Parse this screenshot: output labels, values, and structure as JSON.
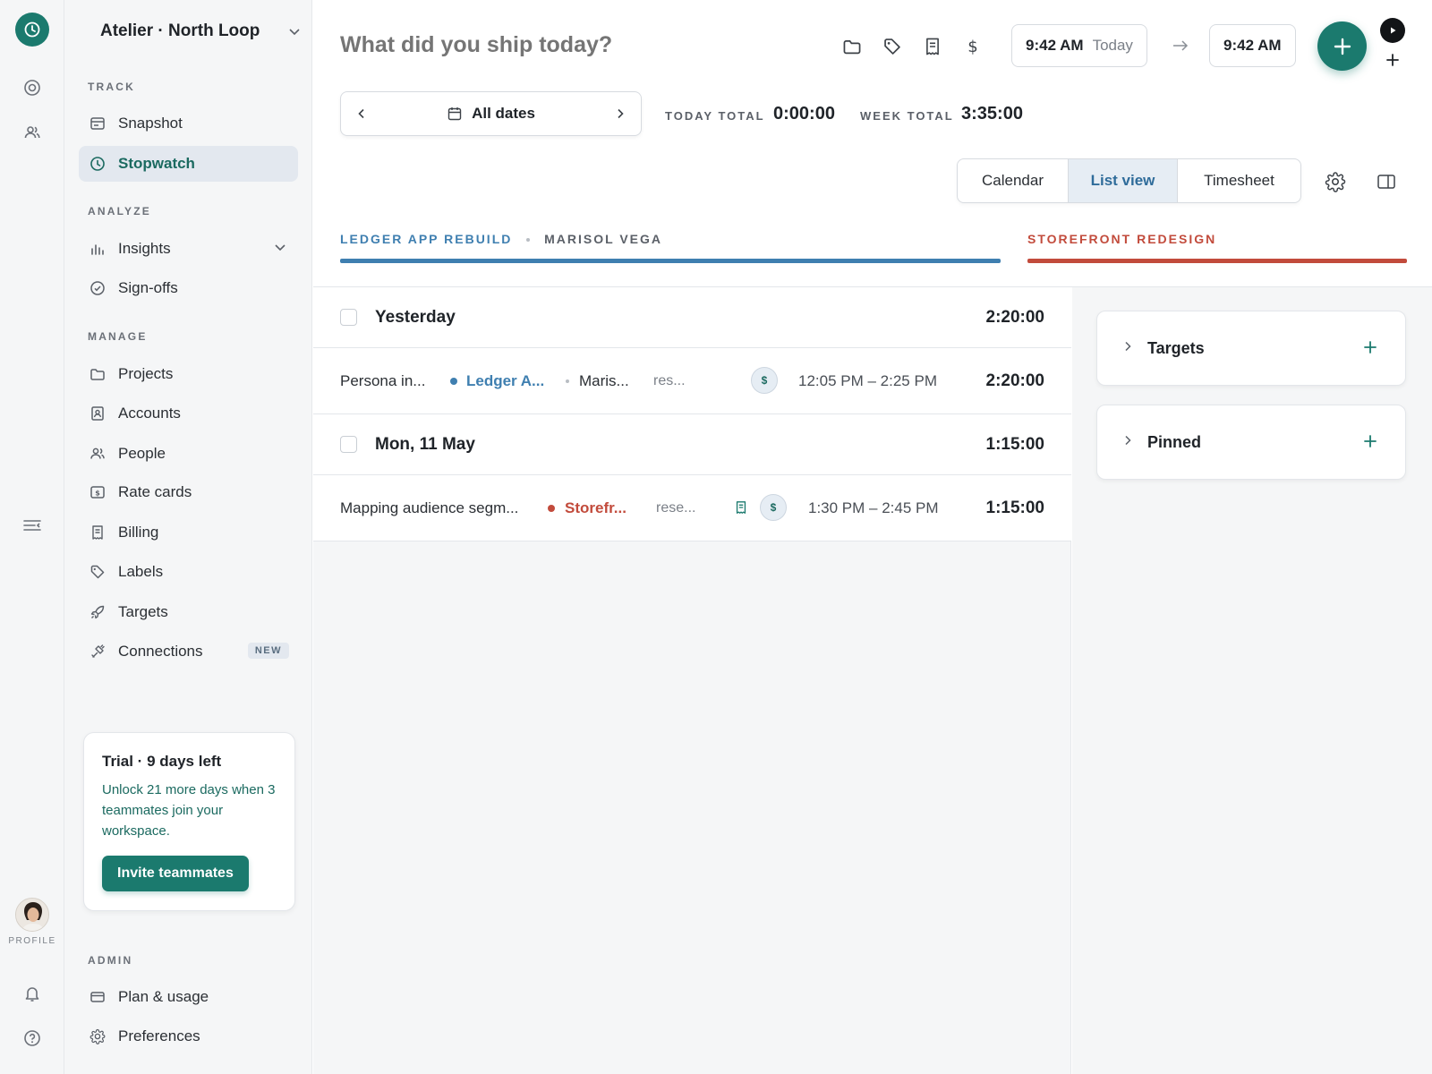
{
  "rail": {
    "profile_label": "PROFILE"
  },
  "workspace": {
    "name": "Atelier · North Loop"
  },
  "sidebar": {
    "sections": {
      "track": "TRACK",
      "analyze": "ANALYZE",
      "manage": "MANAGE",
      "admin": "ADMIN"
    },
    "items": {
      "snapshot": "Snapshot",
      "stopwatch": "Stopwatch",
      "insights": "Insights",
      "signoffs": "Sign-offs",
      "projects": "Projects",
      "accounts": "Accounts",
      "people": "People",
      "ratecards": "Rate cards",
      "billing": "Billing",
      "labels": "Labels",
      "targets": "Targets",
      "connections": "Connections",
      "plan": "Plan & usage",
      "preferences": "Preferences"
    },
    "new_badge": "NEW",
    "active_color": "#1b6a60"
  },
  "trial": {
    "title": "Trial · 9 days left",
    "text": "Unlock 21 more days when 3 teammates join your workspace.",
    "button": "Invite teammates"
  },
  "header": {
    "question": "What did you ship today?",
    "start_time": "9:42 AM",
    "start_day": "Today",
    "end_time": "9:42 AM",
    "accent": "#1b7a6e"
  },
  "dates": {
    "label": "All dates"
  },
  "totals": {
    "today_label": "TODAY TOTAL",
    "today_value": "0:00:00",
    "week_label": "WEEK TOTAL",
    "week_value": "3:35:00"
  },
  "views": {
    "calendar": "Calendar",
    "list": "List view",
    "timesheet": "Timesheet",
    "selected": "List view"
  },
  "projects": [
    {
      "name": "LEDGER APP REBUILD",
      "person": "MARISOL VEGA",
      "color": "#3f7fb0"
    },
    {
      "name": "STOREFRONT REDESIGN",
      "color": "#c24b3c"
    }
  ],
  "groups": [
    {
      "title": "Yesterday",
      "total": "2:20:00",
      "entries": [
        {
          "desc": "Persona in...",
          "project": "Ledger A...",
          "person": "Maris...",
          "tag": "res...",
          "time": "12:05 PM – 2:25 PM",
          "duration": "2:20:00"
        }
      ]
    },
    {
      "title": "Mon, 11 May",
      "total": "1:15:00",
      "entries": [
        {
          "desc": "Mapping audience segm...",
          "project": "Storefr...",
          "tag": "rese...",
          "time": "1:30 PM – 2:45 PM",
          "duration": "1:15:00"
        }
      ]
    }
  ],
  "side_cards": {
    "targets": "Targets",
    "pinned": "Pinned"
  }
}
